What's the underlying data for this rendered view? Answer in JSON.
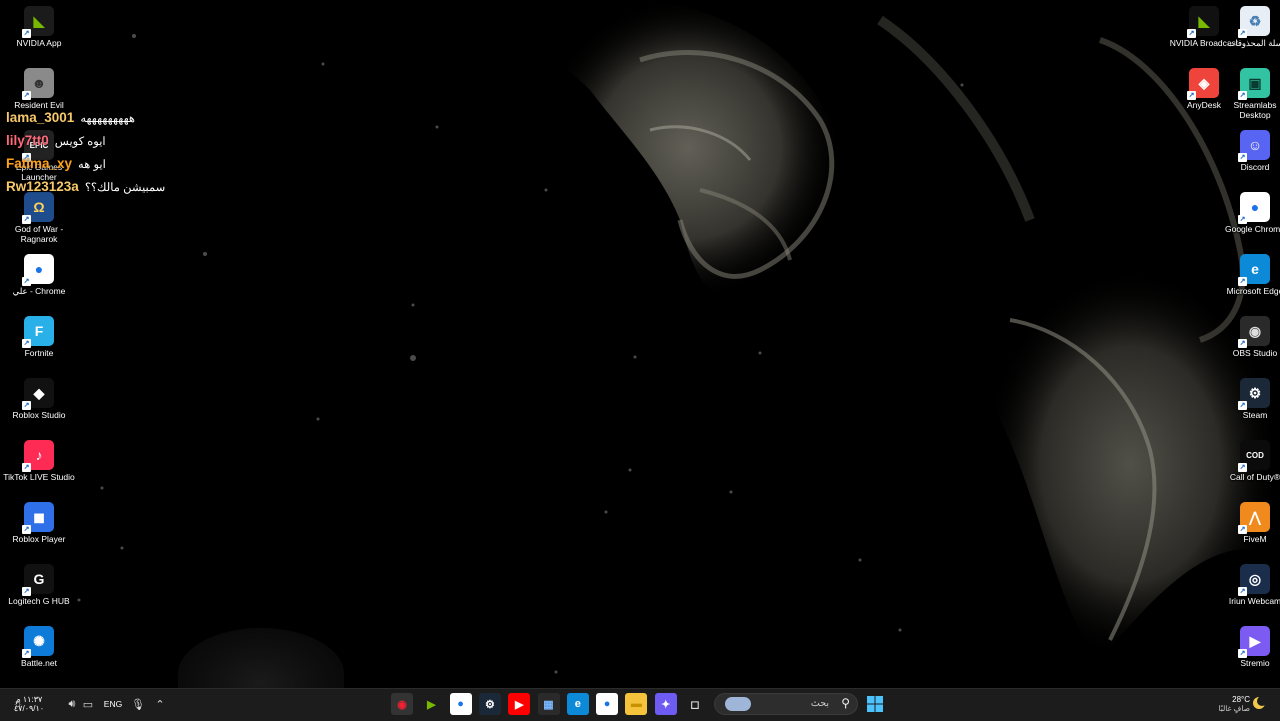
{
  "desktop": {
    "left_icons": [
      {
        "label": "NVIDIA App",
        "icon": "nvidia-app-icon",
        "color": "#1b1b1b",
        "glyph": "◣",
        "fg": "#76b900"
      },
      {
        "label": "Resident Evil",
        "icon": "resident-evil-icon",
        "color": "#8a8a8a",
        "glyph": "☻",
        "fg": "#333"
      },
      {
        "label": "Epic Games Launcher",
        "icon": "epic-games-icon",
        "color": "#222",
        "glyph": "EPIC",
        "fg": "#fff"
      },
      {
        "label": "God of War - Ragnarok",
        "icon": "god-of-war-icon",
        "color": "#1e4c8c",
        "glyph": "Ω",
        "fg": "#ffd35a"
      },
      {
        "label": "علي - Chrome",
        "icon": "chrome-icon",
        "color": "#ffffff",
        "glyph": "●",
        "fg": "#1a73e8"
      },
      {
        "label": "Fortnite",
        "icon": "fortnite-icon",
        "color": "#2ab0e8",
        "glyph": "F",
        "fg": "#fff"
      },
      {
        "label": "Roblox Studio",
        "icon": "roblox-studio-icon",
        "color": "#111",
        "glyph": "◆",
        "fg": "#fff"
      },
      {
        "label": "TikTok LIVE Studio",
        "icon": "tiktok-live-icon",
        "color": "#fe2c55",
        "glyph": "♪",
        "fg": "#fff"
      },
      {
        "label": "Roblox Player",
        "icon": "roblox-player-icon",
        "color": "#2f6fe8",
        "glyph": "◼",
        "fg": "#fff"
      },
      {
        "label": "Logitech G HUB",
        "icon": "logitech-ghub-icon",
        "color": "#111",
        "glyph": "G",
        "fg": "#fff"
      },
      {
        "label": "Battle.net",
        "icon": "battlenet-icon",
        "color": "#0f7bd8",
        "glyph": "✺",
        "fg": "#fff"
      }
    ],
    "right_icons": [
      {
        "label": "NVIDIA Broadcast",
        "icon": "nvidia-broadcast-icon",
        "color": "#111",
        "glyph": "◣",
        "fg": "#76b900",
        "col": 0,
        "row": 0
      },
      {
        "label": "سلة المحذوفات",
        "icon": "recycle-bin-icon",
        "color": "#e8eef5",
        "glyph": "♻",
        "fg": "#4a7fb5",
        "col": 1,
        "row": 0
      },
      {
        "label": "AnyDesk",
        "icon": "anydesk-icon",
        "color": "#ef443b",
        "glyph": "◈",
        "fg": "#fff",
        "col": 0,
        "row": 1
      },
      {
        "label": "Streamlabs Desktop",
        "icon": "streamlabs-icon",
        "color": "#31c3a2",
        "glyph": "▣",
        "fg": "#0a3b30",
        "col": 1,
        "row": 1
      },
      {
        "label": "Discord",
        "icon": "discord-icon",
        "color": "#5865f2",
        "glyph": "☺",
        "fg": "#fff",
        "col": 1,
        "row": 2
      },
      {
        "label": "Google Chrome",
        "icon": "chrome-icon",
        "color": "#ffffff",
        "glyph": "●",
        "fg": "#1a73e8",
        "col": 1,
        "row": 3
      },
      {
        "label": "Microsoft Edge",
        "icon": "edge-icon",
        "color": "#0c8ad8",
        "glyph": "e",
        "fg": "#fff",
        "col": 1,
        "row": 4
      },
      {
        "label": "OBS Studio",
        "icon": "obs-icon",
        "color": "#2a2a2a",
        "glyph": "◉",
        "fg": "#ddd",
        "col": 1,
        "row": 5
      },
      {
        "label": "Steam",
        "icon": "steam-icon",
        "color": "#1b2838",
        "glyph": "⚙",
        "fg": "#fff",
        "col": 1,
        "row": 6
      },
      {
        "label": "Call of Duty®",
        "icon": "call-of-duty-icon",
        "color": "#0b0b0b",
        "glyph": "COD",
        "fg": "#fff",
        "col": 1,
        "row": 7
      },
      {
        "label": "FiveM",
        "icon": "fivem-icon",
        "color": "#f08a1c",
        "glyph": "⋀",
        "fg": "#fff",
        "col": 1,
        "row": 8
      },
      {
        "label": "Iriun Webcam",
        "icon": "iriun-webcam-icon",
        "color": "#1a2e4c",
        "glyph": "◎",
        "fg": "#fff",
        "col": 1,
        "row": 9
      },
      {
        "label": "Stremio",
        "icon": "stremio-icon",
        "color": "#7b5bf2",
        "glyph": "▶",
        "fg": "#fff",
        "col": 1,
        "row": 10
      }
    ]
  },
  "chat": [
    {
      "user": "lama_3001",
      "user_color": "#f7c96a",
      "message": "هههههههههه"
    },
    {
      "user": "lily7tt0",
      "user_color": "#ff6a7a",
      "message": "ايوه كويس"
    },
    {
      "user": "Fatima_xy",
      "user_color": "#ffa11a",
      "message": "ايو هه"
    },
    {
      "user": "Rw123123a",
      "user_color": "#f7c96a",
      "message": "سمبيشن مالك؟؟"
    }
  ],
  "taskbar": {
    "apps": [
      {
        "name": "obs-taskbar-icon",
        "color": "#333",
        "glyph": "◉",
        "fg": "#e23"
      },
      {
        "name": "nvidia-taskbar-icon",
        "color": "#1c1c1c",
        "glyph": "▶",
        "fg": "#76b900"
      },
      {
        "name": "chrome-profile-taskbar-icon",
        "color": "#fff",
        "glyph": "●",
        "fg": "#1a73e8"
      },
      {
        "name": "steam-taskbar-icon",
        "color": "#1b2838",
        "glyph": "⚙",
        "fg": "#fff"
      },
      {
        "name": "youtube-taskbar-icon",
        "color": "#ff0000",
        "glyph": "▶",
        "fg": "#fff"
      },
      {
        "name": "microsoft-store-taskbar-icon",
        "color": "#2a2a2a",
        "glyph": "▦",
        "fg": "#7ab8ff"
      },
      {
        "name": "edge-taskbar-icon",
        "color": "#0c8ad8",
        "glyph": "e",
        "fg": "#fff"
      },
      {
        "name": "chrome-taskbar-icon",
        "color": "#fff",
        "glyph": "●",
        "fg": "#1a73e8"
      },
      {
        "name": "file-explorer-taskbar-icon",
        "color": "#f5c33b",
        "glyph": "▬",
        "fg": "#c99000"
      },
      {
        "name": "copilot-taskbar-icon",
        "color": "#6e5bf2",
        "glyph": "✦",
        "fg": "#fff"
      },
      {
        "name": "task-view-taskbar-icon",
        "color": "#1c1c1c",
        "glyph": "◻",
        "fg": "#ddd"
      }
    ],
    "search_placeholder": "بحث",
    "start_icon": "windows-start-icon",
    "weather_temp": "28°C",
    "weather_desc": "صافٍ غالبًا",
    "language": "ENG",
    "clock_time": "١١:٣٧ م",
    "clock_date": "٤٧/٠٩/١٠"
  }
}
